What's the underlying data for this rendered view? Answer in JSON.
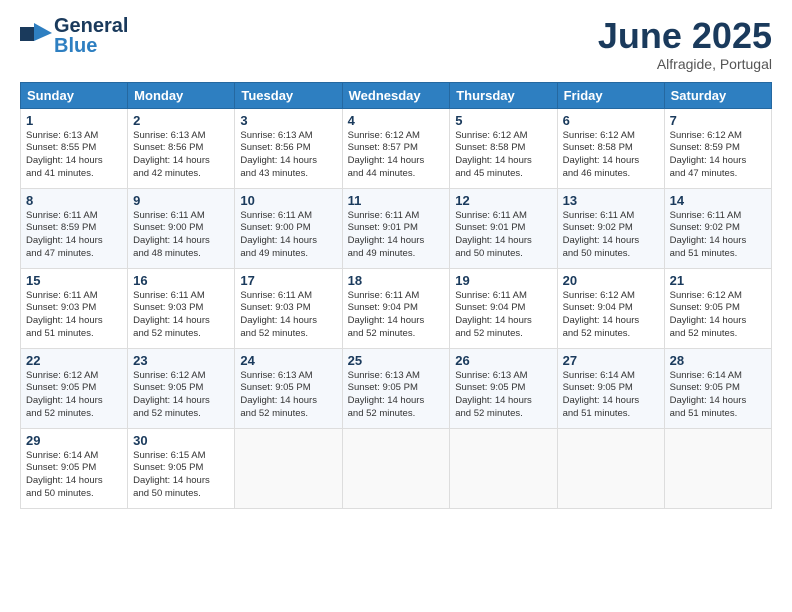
{
  "header": {
    "logo_general": "General",
    "logo_blue": "Blue",
    "month_title": "June 2025",
    "location": "Alfragide, Portugal"
  },
  "weekdays": [
    "Sunday",
    "Monday",
    "Tuesday",
    "Wednesday",
    "Thursday",
    "Friday",
    "Saturday"
  ],
  "weeks": [
    [
      {
        "day": "1",
        "info": "Sunrise: 6:13 AM\nSunset: 8:55 PM\nDaylight: 14 hours\nand 41 minutes."
      },
      {
        "day": "2",
        "info": "Sunrise: 6:13 AM\nSunset: 8:56 PM\nDaylight: 14 hours\nand 42 minutes."
      },
      {
        "day": "3",
        "info": "Sunrise: 6:13 AM\nSunset: 8:56 PM\nDaylight: 14 hours\nand 43 minutes."
      },
      {
        "day": "4",
        "info": "Sunrise: 6:12 AM\nSunset: 8:57 PM\nDaylight: 14 hours\nand 44 minutes."
      },
      {
        "day": "5",
        "info": "Sunrise: 6:12 AM\nSunset: 8:58 PM\nDaylight: 14 hours\nand 45 minutes."
      },
      {
        "day": "6",
        "info": "Sunrise: 6:12 AM\nSunset: 8:58 PM\nDaylight: 14 hours\nand 46 minutes."
      },
      {
        "day": "7",
        "info": "Sunrise: 6:12 AM\nSunset: 8:59 PM\nDaylight: 14 hours\nand 47 minutes."
      }
    ],
    [
      {
        "day": "8",
        "info": "Sunrise: 6:11 AM\nSunset: 8:59 PM\nDaylight: 14 hours\nand 47 minutes."
      },
      {
        "day": "9",
        "info": "Sunrise: 6:11 AM\nSunset: 9:00 PM\nDaylight: 14 hours\nand 48 minutes."
      },
      {
        "day": "10",
        "info": "Sunrise: 6:11 AM\nSunset: 9:00 PM\nDaylight: 14 hours\nand 49 minutes."
      },
      {
        "day": "11",
        "info": "Sunrise: 6:11 AM\nSunset: 9:01 PM\nDaylight: 14 hours\nand 49 minutes."
      },
      {
        "day": "12",
        "info": "Sunrise: 6:11 AM\nSunset: 9:01 PM\nDaylight: 14 hours\nand 50 minutes."
      },
      {
        "day": "13",
        "info": "Sunrise: 6:11 AM\nSunset: 9:02 PM\nDaylight: 14 hours\nand 50 minutes."
      },
      {
        "day": "14",
        "info": "Sunrise: 6:11 AM\nSunset: 9:02 PM\nDaylight: 14 hours\nand 51 minutes."
      }
    ],
    [
      {
        "day": "15",
        "info": "Sunrise: 6:11 AM\nSunset: 9:03 PM\nDaylight: 14 hours\nand 51 minutes."
      },
      {
        "day": "16",
        "info": "Sunrise: 6:11 AM\nSunset: 9:03 PM\nDaylight: 14 hours\nand 52 minutes."
      },
      {
        "day": "17",
        "info": "Sunrise: 6:11 AM\nSunset: 9:03 PM\nDaylight: 14 hours\nand 52 minutes."
      },
      {
        "day": "18",
        "info": "Sunrise: 6:11 AM\nSunset: 9:04 PM\nDaylight: 14 hours\nand 52 minutes."
      },
      {
        "day": "19",
        "info": "Sunrise: 6:11 AM\nSunset: 9:04 PM\nDaylight: 14 hours\nand 52 minutes."
      },
      {
        "day": "20",
        "info": "Sunrise: 6:12 AM\nSunset: 9:04 PM\nDaylight: 14 hours\nand 52 minutes."
      },
      {
        "day": "21",
        "info": "Sunrise: 6:12 AM\nSunset: 9:05 PM\nDaylight: 14 hours\nand 52 minutes."
      }
    ],
    [
      {
        "day": "22",
        "info": "Sunrise: 6:12 AM\nSunset: 9:05 PM\nDaylight: 14 hours\nand 52 minutes."
      },
      {
        "day": "23",
        "info": "Sunrise: 6:12 AM\nSunset: 9:05 PM\nDaylight: 14 hours\nand 52 minutes."
      },
      {
        "day": "24",
        "info": "Sunrise: 6:13 AM\nSunset: 9:05 PM\nDaylight: 14 hours\nand 52 minutes."
      },
      {
        "day": "25",
        "info": "Sunrise: 6:13 AM\nSunset: 9:05 PM\nDaylight: 14 hours\nand 52 minutes."
      },
      {
        "day": "26",
        "info": "Sunrise: 6:13 AM\nSunset: 9:05 PM\nDaylight: 14 hours\nand 52 minutes."
      },
      {
        "day": "27",
        "info": "Sunrise: 6:14 AM\nSunset: 9:05 PM\nDaylight: 14 hours\nand 51 minutes."
      },
      {
        "day": "28",
        "info": "Sunrise: 6:14 AM\nSunset: 9:05 PM\nDaylight: 14 hours\nand 51 minutes."
      }
    ],
    [
      {
        "day": "29",
        "info": "Sunrise: 6:14 AM\nSunset: 9:05 PM\nDaylight: 14 hours\nand 50 minutes."
      },
      {
        "day": "30",
        "info": "Sunrise: 6:15 AM\nSunset: 9:05 PM\nDaylight: 14 hours\nand 50 minutes."
      },
      {
        "day": "",
        "info": ""
      },
      {
        "day": "",
        "info": ""
      },
      {
        "day": "",
        "info": ""
      },
      {
        "day": "",
        "info": ""
      },
      {
        "day": "",
        "info": ""
      }
    ]
  ]
}
